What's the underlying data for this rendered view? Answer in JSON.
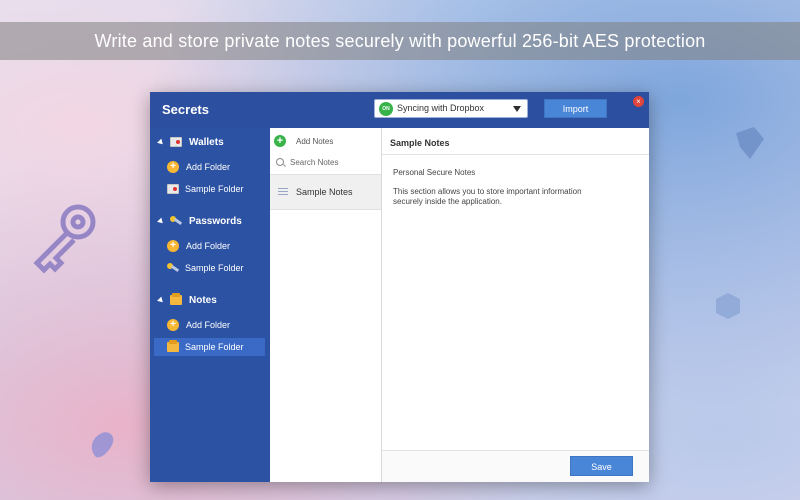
{
  "banner": {
    "headline": "Write and store private notes securely with powerful 256-bit AES protection"
  },
  "window": {
    "title": "Secrets",
    "sync": {
      "badge": "ON",
      "label": "Syncing with Dropbox"
    },
    "import_label": "Import",
    "close_glyph": "×"
  },
  "sidebar": {
    "sections": [
      {
        "label": "Wallets",
        "icon": "wallet-icon",
        "items": [
          {
            "label": "Add Folder",
            "icon": "add-folder-icon"
          },
          {
            "label": "Sample Folder",
            "icon": "wallet-folder-icon"
          }
        ]
      },
      {
        "label": "Passwords",
        "icon": "key-icon",
        "items": [
          {
            "label": "Add Folder",
            "icon": "add-folder-icon"
          },
          {
            "label": "Sample Folder",
            "icon": "key-folder-icon"
          }
        ]
      },
      {
        "label": "Notes",
        "icon": "notes-icon",
        "items": [
          {
            "label": "Add Folder",
            "icon": "add-folder-icon"
          },
          {
            "label": "Sample Folder",
            "icon": "notes-folder-icon"
          }
        ]
      }
    ]
  },
  "notes_list": {
    "add_label": "Add Notes",
    "add_glyph": "+",
    "search_placeholder": "Search Notes",
    "items": [
      {
        "label": "Sample Notes"
      }
    ]
  },
  "detail": {
    "title": "Sample Notes",
    "subtitle": "Personal Secure Notes",
    "body": "This section allows you to store important information securely inside the application.",
    "save_label": "Save"
  },
  "colors": {
    "titlebar": "#2d4fa0",
    "sidebar": "#2c52a3",
    "selected": "#3a69c6",
    "button": "#4a86d8",
    "sync_on": "#37b34a",
    "close": "#e0453b"
  }
}
